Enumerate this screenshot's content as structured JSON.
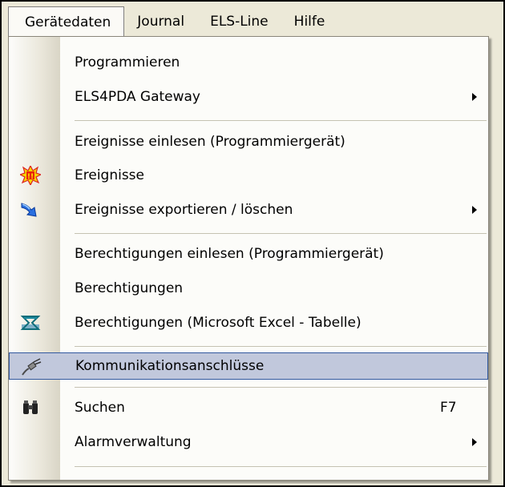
{
  "menubar": {
    "items": [
      {
        "label": "Gerätedaten"
      },
      {
        "label": "Journal"
      },
      {
        "label": "ELS-Line"
      },
      {
        "label": "Hilfe"
      }
    ]
  },
  "menu": {
    "programmieren": "Programmieren",
    "els4pda_gateway": "ELS4PDA Gateway",
    "ereignisse_einlesen": "Ereignisse einlesen (Programmiergerät)",
    "ereignisse": "Ereignisse",
    "ereignisse_exportieren": "Ereignisse exportieren / löschen",
    "berechtigungen_einlesen": "Berechtigungen einlesen (Programmiergerät)",
    "berechtigungen": "Berechtigungen",
    "berechtigungen_excel": "Berechtigungen (Microsoft Excel - Tabelle)",
    "kommunikationsanschluesse": "Kommunikationsanschlüsse",
    "suchen": "Suchen",
    "suchen_shortcut": "F7",
    "alarmverwaltung": "Alarmverwaltung"
  },
  "colors": {
    "highlight_fill": "#c1c8dc",
    "highlight_border": "#31589f"
  },
  "icons": {
    "ereignisse": "alert-burst-icon",
    "ereignisse_exportieren": "arrow-export-icon",
    "berechtigungen_excel": "excel-icon",
    "kommunikationsanschluesse": "connector-icon",
    "suchen": "binoculars-icon"
  }
}
